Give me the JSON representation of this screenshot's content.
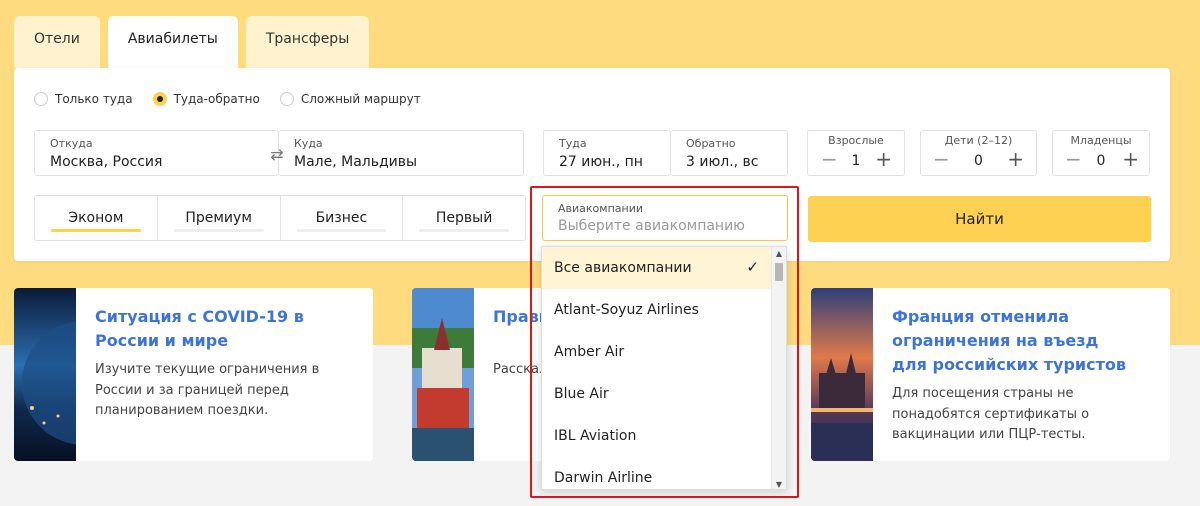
{
  "tabs": [
    "Отели",
    "Авиабилеты",
    "Трансферы"
  ],
  "trip_types": [
    "Только туда",
    "Туда-обратно",
    "Сложный маршрут"
  ],
  "route": {
    "from_label": "Откуда",
    "from_value": "Москва, Россия",
    "to_label": "Куда",
    "to_value": "Мале, Мальдивы"
  },
  "dates": {
    "depart_label": "Туда",
    "depart_value": "27 июн., пн",
    "return_label": "Обратно",
    "return_value": "3 июл., вс"
  },
  "passengers": [
    {
      "label": "Взрослые",
      "count": "1"
    },
    {
      "label": "Дети (2–12)",
      "count": "0"
    },
    {
      "label": "Младенцы",
      "count": "0"
    }
  ],
  "classes": [
    "Эконом",
    "Премиум",
    "Бизнес",
    "Первый"
  ],
  "airline": {
    "label": "Авиакомпании",
    "placeholder": "Выберите авиакомпанию",
    "options": [
      "Все авиакомпании",
      "Atlant-Soyuz Airlines",
      "Amber Air",
      "Blue Air",
      "IBL Aviation",
      "Darwin Airline"
    ]
  },
  "search_label": "Найти",
  "news": [
    {
      "title": "Ситуация с COVID-19 в России и мире",
      "desc": "Изучите текущие ограничения в России и за границей перед планированием поездки."
    },
    {
      "title": "Прави... Сканд...",
      "desc": "Расска... услови... россий..."
    },
    {
      "title": "Франция отменила ограничения на въезд для российских туристов",
      "desc": "Для посещения страны не понадобятся сертификаты о вакцинации или ПЦР-тесты."
    }
  ],
  "icons": {
    "swap": "swap-arrows-icon",
    "check": "checkmark-icon",
    "minus": "minus-icon",
    "plus": "plus-icon"
  },
  "colors": {
    "hero": "#fedb7f",
    "accent": "#fdd152",
    "link": "#3d74d6",
    "highlight": "#e0151b"
  }
}
